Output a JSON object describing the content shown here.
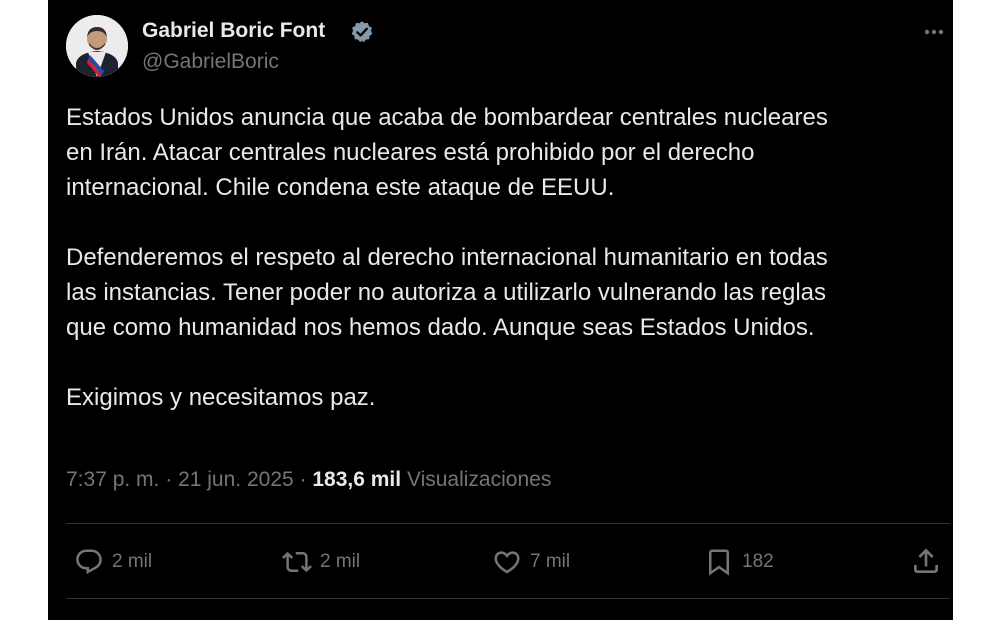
{
  "author": {
    "display_name": "Gabriel Boric Font",
    "handle": "@GabrielBoric",
    "verified": true
  },
  "tweet": {
    "paragraphs": [
      [
        "Estados Unidos anuncia que acaba de bombardear centrales nucleares",
        "en Irán. Atacar centrales nucleares está prohibido por el derecho",
        "internacional. Chile condena este ataque de EEUU."
      ],
      [
        "Defenderemos el respeto al derecho internacional humanitario en todas",
        "las instancias. Tener poder no autoriza a utilizarlo vulnerando las reglas",
        "que como humanidad nos hemos dado. Aunque seas Estados Unidos."
      ],
      [
        "Exigimos y necesitamos paz."
      ]
    ],
    "time": "7:37 p. m.",
    "separator": "·",
    "date": "21 jun. 2025",
    "views_count": "183,6 mil",
    "views_label": "Visualizaciones"
  },
  "actions": {
    "replies": "2 mil",
    "reposts": "2 mil",
    "likes": "7 mil",
    "bookmarks": "182"
  },
  "icons": [
    "verified-badge-icon",
    "more-icon",
    "reply-icon",
    "repost-icon",
    "like-icon",
    "bookmark-icon",
    "share-icon"
  ],
  "colors": {
    "background": "#000000",
    "text": "#e7e9ea",
    "secondary_text": "#71767b",
    "verified": "#829aab",
    "divider": "#2f3336"
  }
}
